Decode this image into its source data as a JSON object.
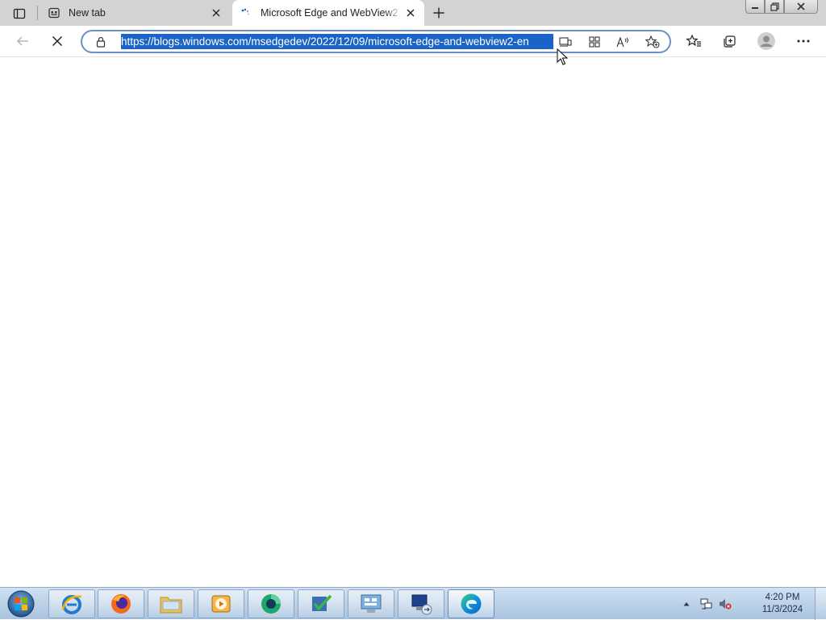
{
  "browser": {
    "tabs": [
      {
        "title": "New tab",
        "icon": "new-tab-page-icon",
        "active": false
      },
      {
        "title": "Microsoft Edge and WebView2 e",
        "icon": "loading-spinner-icon",
        "active": true
      }
    ],
    "address_bar": {
      "url": "https://blogs.windows.com/msedgedev/2022/12/09/microsoft-edge-and-webview2-en",
      "selected": true
    },
    "toolbar": {
      "back": "back-arrow-icon",
      "stop": "stop-loading-icon",
      "page_actions": [
        "immersive-reader-icon",
        "app-available-icon",
        "read-aloud-icon",
        "add-favorite-icon"
      ],
      "right": [
        "favorites-icon",
        "collections-icon",
        "profile-avatar",
        "settings-more-icon"
      ]
    }
  },
  "taskbar": {
    "pinned": [
      "internet-explorer",
      "firefox",
      "file-explorer",
      "media-player",
      "green-app",
      "task-check-app",
      "control-panel",
      "remote-desktop",
      "microsoft-edge"
    ],
    "clock": {
      "time": "4:20 PM",
      "date": "11/3/2024"
    }
  },
  "colors": {
    "selection": "#1a64c8",
    "tabstrip": "#d3d3d3",
    "address_border": "#6b8fc7"
  }
}
